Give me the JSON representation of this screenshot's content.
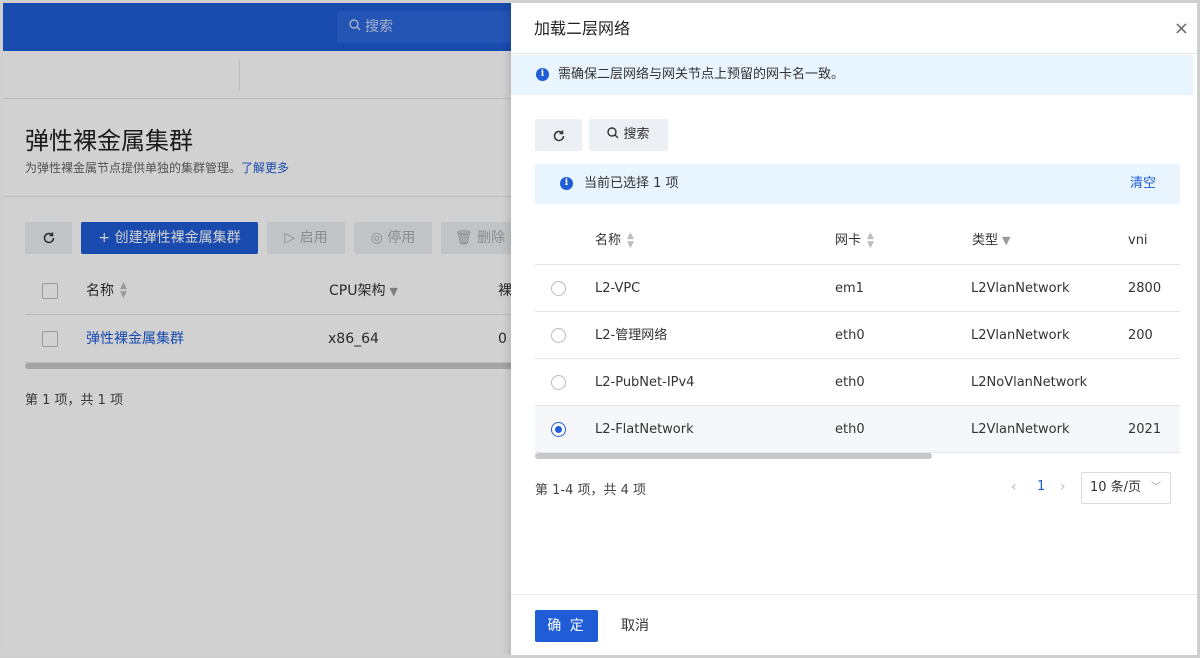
{
  "background": {
    "search_placeholder": "搜索",
    "page_title": "弹性裸金属集群",
    "page_desc": "为弹性裸金属节点提供单独的集群管理。",
    "learn_more": "了解更多",
    "toolbar": {
      "create_label": "创建弹性裸金属集群",
      "start_label": "启用",
      "stop_label": "停用",
      "delete_label": "删除"
    },
    "table": {
      "col_name": "名称",
      "col_cpu": "CPU架构",
      "col_partial": "裸",
      "rows": [
        {
          "name": "弹性裸金属集群",
          "cpu": "x86_64",
          "count": "0"
        }
      ]
    },
    "footer": "第 1 项，共 1 项"
  },
  "drawer": {
    "title": "加载二层网络",
    "close_icon": "×",
    "alert": "需确保二层网络与网关节点上预留的网卡名一致。",
    "search_label": "搜索",
    "selection": {
      "text": "当前已选择 1 项",
      "clear_label": "清空"
    },
    "columns": {
      "name": "名称",
      "nic": "网卡",
      "type": "类型",
      "vni": "vni"
    },
    "rows": [
      {
        "name": "L2-VPC",
        "nic": "em1",
        "type": "L2VlanNetwork",
        "vni": "2800",
        "selected": false
      },
      {
        "name": "L2-管理网络",
        "nic": "eth0",
        "type": "L2VlanNetwork",
        "vni": "200",
        "selected": false
      },
      {
        "name": "L2-PubNet-IPv4",
        "nic": "eth0",
        "type": "L2NoVlanNetwork",
        "vni": "",
        "selected": false
      },
      {
        "name": "L2-FlatNetwork",
        "nic": "eth0",
        "type": "L2VlanNetwork",
        "vni": "2021",
        "selected": true
      }
    ],
    "pager": {
      "info": "第 1-4 项，共 4 项",
      "current_page": "1",
      "page_size": "10 条/页"
    },
    "ok_label": "确 定",
    "cancel_label": "取消"
  },
  "colors": {
    "primary": "#1f5cd6",
    "alert_bg": "#e8f4fe"
  }
}
